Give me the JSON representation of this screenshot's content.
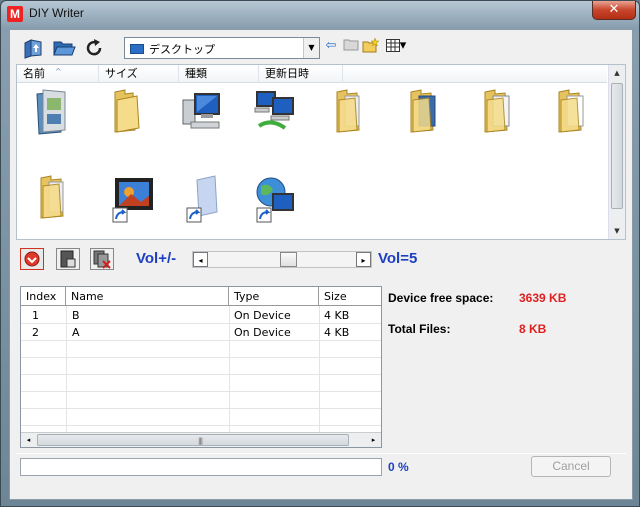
{
  "window": {
    "title": "DIY Writer",
    "app_icon_letter": "M",
    "close_glyph": "✕"
  },
  "toolbar": {
    "location_value": "デスクトップ",
    "combo_arrow": "▼",
    "back_glyph": "⇦",
    "view_menu_glyph": "▾"
  },
  "browser": {
    "columns": [
      "名前",
      "サイズ",
      "種類",
      "更新日時"
    ],
    "sort_glyph": "^",
    "items": [
      {
        "icon": "user-folder-icon"
      },
      {
        "icon": "folder-icon"
      },
      {
        "icon": "computer-icon"
      },
      {
        "icon": "network-icon"
      },
      {
        "icon": "folder-doc-icon"
      },
      {
        "icon": "folder-doc-icon"
      },
      {
        "icon": "folder-doc-icon"
      },
      {
        "icon": "folder-doc-icon"
      },
      {
        "icon": "folder-doc-icon"
      },
      {
        "icon": "video-shortcut-icon"
      },
      {
        "icon": "document-shortcut-icon"
      },
      {
        "icon": "internet-shortcut-icon"
      }
    ]
  },
  "volume": {
    "label": "Vol+/-",
    "value_text": "Vol=5",
    "level_fraction": 0.55,
    "left_glyph": "◂",
    "right_glyph": "▸"
  },
  "device_table": {
    "headers": [
      "Index",
      "Name",
      "Type",
      "Size"
    ],
    "rows": [
      {
        "index": "1",
        "name": "B",
        "type": "On Device",
        "size": "4 KB"
      },
      {
        "index": "2",
        "name": "A",
        "type": "On Device",
        "size": "4 KB"
      }
    ],
    "scroll_left": "◂",
    "scroll_right": "▸",
    "grip": "|||"
  },
  "info": {
    "free_space_label": "Device free space:",
    "free_space_value": "3639 KB",
    "total_files_label": "Total Files:",
    "total_files_value": "8 KB"
  },
  "progress": {
    "percent_text": "0 %",
    "fraction": 0
  },
  "buttons": {
    "cancel": "Cancel"
  }
}
